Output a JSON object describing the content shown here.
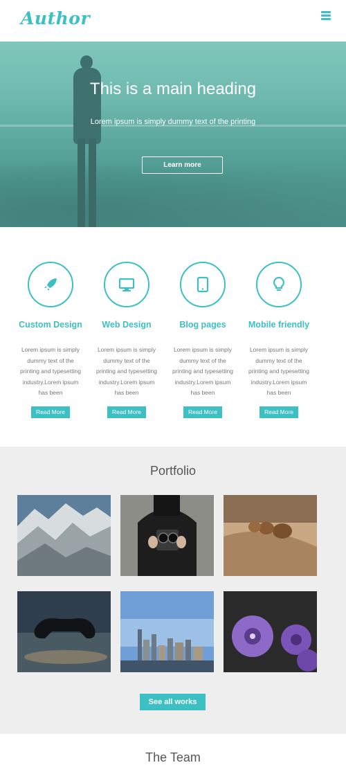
{
  "brand": {
    "logo": "Author",
    "accent": "#3cc0c3"
  },
  "nav": {
    "menu_icon": "hamburger-icon"
  },
  "hero": {
    "heading": "This is a main heading",
    "subtext": "Lorem ipsum is simply dummy text of the printing",
    "button": "Learn more"
  },
  "services": [
    {
      "icon": "rocket-icon",
      "title": "Custom Design",
      "text": "Lorem ipsum is simply dummy text of the printing and typesetting industry.Lorem ipsum has been",
      "button": "Read More"
    },
    {
      "icon": "monitor-icon",
      "title": "Web Design",
      "text": "Lorem ipsum is simply dummy text of the printing and typesetting industry.Lorem ipsum has been",
      "button": "Read More"
    },
    {
      "icon": "tablet-icon",
      "title": "Blog pages",
      "text": "Lorem ipsum is simply dummy text of the printing and typesetting industry.Lorem ipsum has been",
      "button": "Read More"
    },
    {
      "icon": "lightbulb-icon",
      "title": "Mobile friendly",
      "text": "Lorem ipsum is simply dummy text of the printing and typesetting industry.Lorem ipsum has been",
      "button": "Read More"
    }
  ],
  "portfolio": {
    "title": "Portfolio",
    "items": [
      "mountains",
      "camera",
      "shells",
      "gamepad",
      "city-skyline",
      "purple-flowers"
    ],
    "button": "See all works"
  },
  "team": {
    "title": "The Team"
  }
}
